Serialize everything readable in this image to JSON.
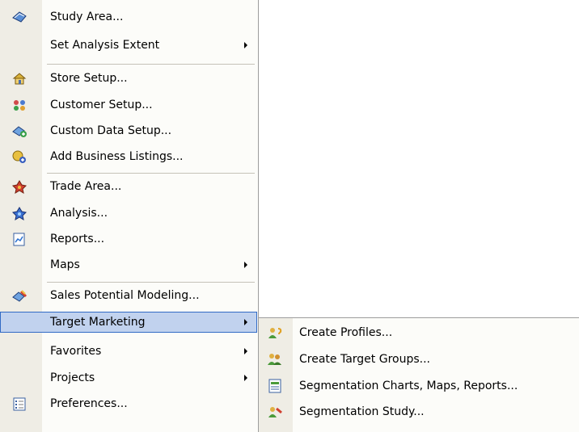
{
  "main_menu": {
    "items": [
      {
        "label": "Study Area...",
        "icon": "study-area-icon"
      },
      {
        "label": "Set Analysis Extent",
        "submenu": true
      },
      {
        "label": "Store Setup...",
        "icon": "store-setup-icon"
      },
      {
        "label": "Customer Setup...",
        "icon": "customer-setup-icon"
      },
      {
        "label": "Custom Data Setup...",
        "icon": "custom-data-icon"
      },
      {
        "label": "Add Business Listings...",
        "icon": "add-business-icon"
      },
      {
        "label": "Trade Area...",
        "icon": "trade-area-icon"
      },
      {
        "label": "Analysis...",
        "icon": "analysis-icon"
      },
      {
        "label": "Reports...",
        "icon": "reports-icon"
      },
      {
        "label": "Maps",
        "submenu": true
      },
      {
        "label": "Sales Potential Modeling...",
        "icon": "sales-potential-icon"
      },
      {
        "label": "Target Marketing",
        "submenu": true,
        "highlighted": true
      },
      {
        "label": "Favorites",
        "submenu": true
      },
      {
        "label": "Projects",
        "submenu": true
      },
      {
        "label": "Preferences...",
        "icon": "preferences-icon"
      }
    ]
  },
  "submenu": {
    "items": [
      {
        "label": "Create Profiles...",
        "icon": "create-profiles-icon"
      },
      {
        "label": "Create Target Groups...",
        "icon": "target-groups-icon"
      },
      {
        "label": "Segmentation Charts, Maps, Reports...",
        "icon": "segmentation-charts-icon"
      },
      {
        "label": "Segmentation Study...",
        "icon": "segmentation-study-icon"
      }
    ]
  },
  "colors": {
    "highlight_fill": "#c1d2ee",
    "highlight_border": "#316ac5",
    "icon_strip": "#efede5"
  }
}
